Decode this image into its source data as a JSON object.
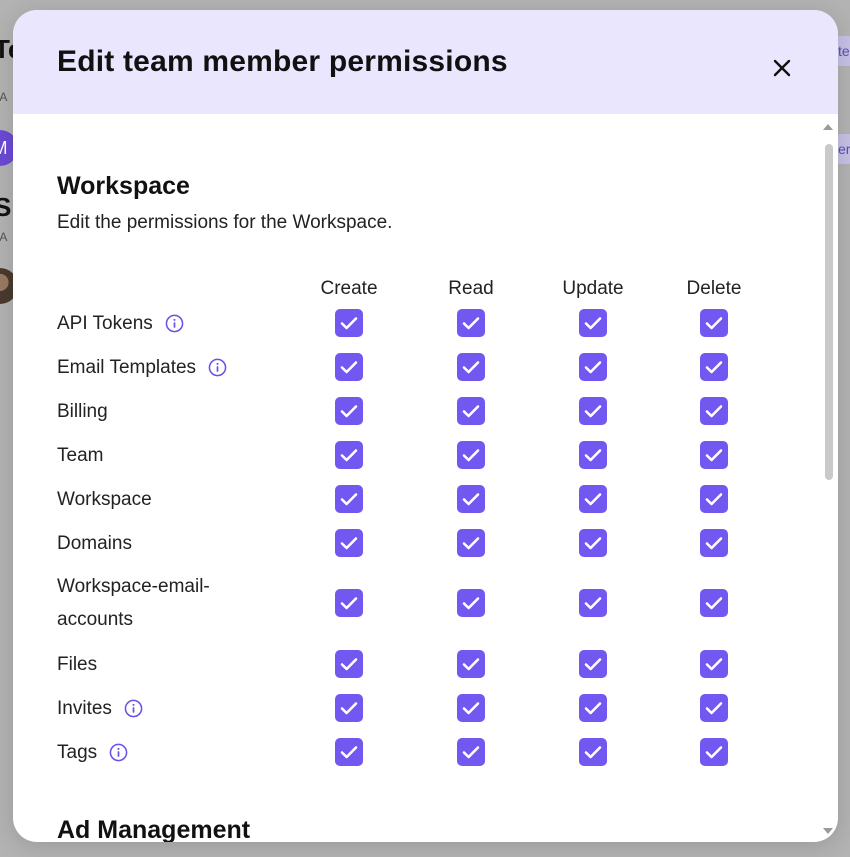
{
  "background": {
    "fragments": [
      "Te",
      "S",
      "M"
    ],
    "pill_fragments": [
      "te",
      "er"
    ]
  },
  "modal": {
    "title": "Edit team member permissions",
    "close_icon": "close-icon",
    "section": {
      "title": "Workspace",
      "description": "Edit the permissions for the Workspace."
    },
    "columns": [
      "Create",
      "Read",
      "Update",
      "Delete"
    ],
    "rows": [
      {
        "label": "API Tokens",
        "info": true,
        "checked": [
          true,
          true,
          true,
          true
        ]
      },
      {
        "label": "Email Templates",
        "info": true,
        "checked": [
          true,
          true,
          true,
          true
        ]
      },
      {
        "label": "Billing",
        "info": false,
        "checked": [
          true,
          true,
          true,
          true
        ]
      },
      {
        "label": "Team",
        "info": false,
        "checked": [
          true,
          true,
          true,
          true
        ]
      },
      {
        "label": "Workspace",
        "info": false,
        "checked": [
          true,
          true,
          true,
          true
        ]
      },
      {
        "label": "Domains",
        "info": false,
        "checked": [
          true,
          true,
          true,
          true
        ]
      },
      {
        "label": "Workspace-email-accounts",
        "line1": "Workspace-email-",
        "line2": "accounts",
        "info": false,
        "checked": [
          true,
          true,
          true,
          true
        ]
      },
      {
        "label": "Files",
        "info": false,
        "checked": [
          true,
          true,
          true,
          true
        ]
      },
      {
        "label": "Invites",
        "info": true,
        "checked": [
          true,
          true,
          true,
          true
        ]
      },
      {
        "label": "Tags",
        "info": true,
        "checked": [
          true,
          true,
          true,
          true
        ]
      }
    ],
    "next_section_title": "Ad Management"
  },
  "colors": {
    "accent": "#7257f0",
    "header_bg": "#e9e6fd",
    "info_icon": "#6a4fe8"
  }
}
